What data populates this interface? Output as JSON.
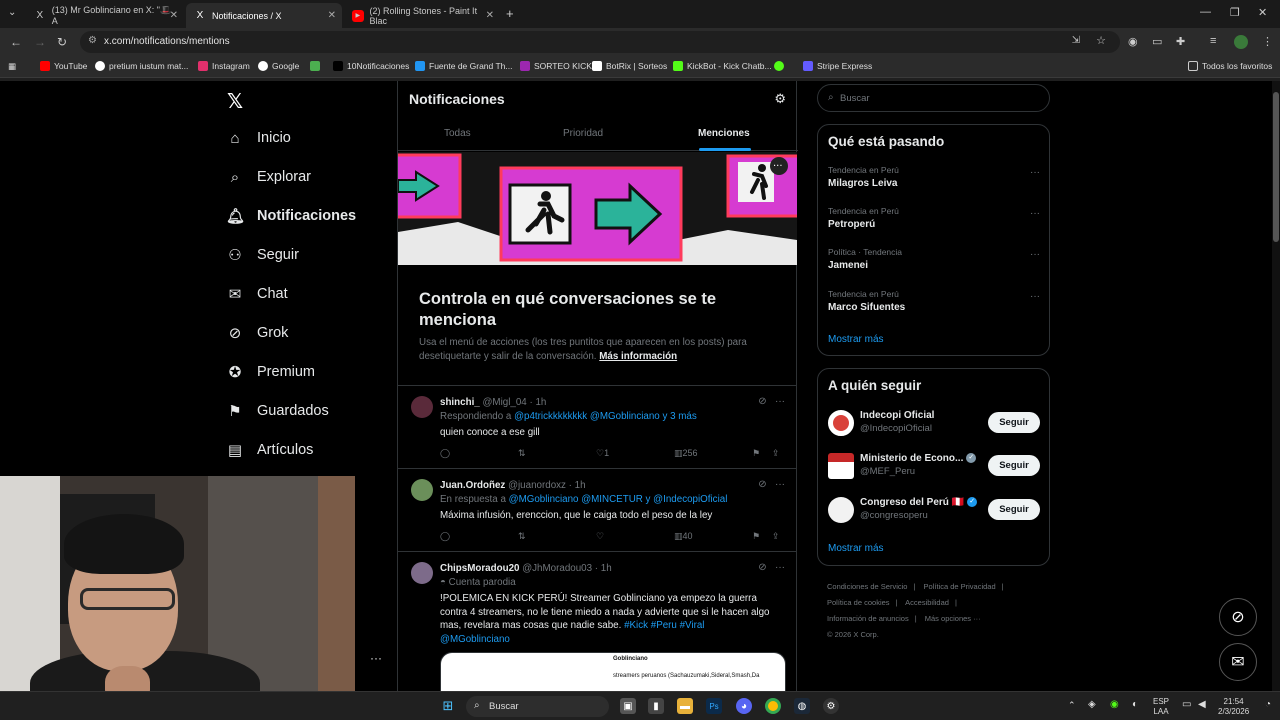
{
  "browser": {
    "tabs": [
      {
        "label": "(13) Mr Goblinciano en X: \"🎩 A",
        "icon": "X"
      },
      {
        "label": "Notificaciones / X",
        "icon": "X"
      },
      {
        "label": "(2) Rolling Stones - Paint It Blac",
        "icon": "▶"
      }
    ],
    "new_tab": "+",
    "url": "x.com/notifications/mentions",
    "bookmarks": [
      "YouTube",
      "pretium iustum mat...",
      "Instagram",
      "Google",
      "",
      "10Notificaciones",
      "Fuente de Grand Th...",
      "SORTEO KICK",
      "BotRix | Sorteos",
      "KickBot - Kick Chatb...",
      "",
      "Stripe Express"
    ],
    "bookmarks_all": "Todos los favoritos"
  },
  "nav": {
    "items": [
      "Inicio",
      "Explorar",
      "Notificaciones",
      "Seguir",
      "Chat",
      "Grok",
      "Premium",
      "Guardados",
      "Artículos"
    ]
  },
  "header": {
    "title": "Notificaciones",
    "tabs": [
      "Todas",
      "Prioridad",
      "Menciones"
    ]
  },
  "promo": {
    "title": "Controla en qué conversaciones se te menciona",
    "body": "Usa el menú de acciones (los tres puntitos que aparecen en los posts) para desetiquetarte y salir de la conversación.",
    "link": "Más información"
  },
  "posts": [
    {
      "name": "shinchi_",
      "handle": "@Migl_04 · 1h",
      "meta_prefix": "Respondiendo a ",
      "meta_links": "@p4trickkkkkkkk @MGoblinciano y 3 más",
      "text": "quien conoce a ese gill",
      "likes": "1",
      "views": "256"
    },
    {
      "name": "Juan.Ordoñez",
      "handle": "@juanordoxz · 1h",
      "meta_prefix": "En respuesta a ",
      "meta_links": "@MGoblinciano @MINCETUR y @IndecopiOficial",
      "text": "Máxima infusión, erenccion, que le caiga todo el peso de la ley",
      "likes": "",
      "views": "40"
    },
    {
      "name": "ChipsMoradou20",
      "handle": "@JhMoradou03 · 1h",
      "meta_prefix": "Cuenta parodia",
      "meta_links": "",
      "text": "!POLEMICA EN KICK PERÚ! Streamer Goblinciano ya empezo la guerra contra 4 streamers, no le tiene miedo a nada y advierte que si le hacen algo mas, revelara mas cosas que nadie sabe. ",
      "tags": "#Kick #Peru #Viral",
      "mention": "@MGoblinciano",
      "card_line1": "Goblinciano",
      "card_line2": "streamers peruanos (Sachauzumaki,Sideral,Smash,Da"
    }
  ],
  "search": {
    "placeholder": "Buscar"
  },
  "trends": {
    "title": "Qué está pasando",
    "items": [
      {
        "category": "Tendencia en Perú",
        "title": "Milagros Leiva"
      },
      {
        "category": "Tendencia en Perú",
        "title": "Petroperú"
      },
      {
        "category": "Política · Tendencia",
        "title": "Jamenei"
      },
      {
        "category": "Tendencia en Perú",
        "title": "Marco Sifuentes"
      }
    ],
    "show_more": "Mostrar más"
  },
  "who_to_follow": {
    "title": "A quién seguir",
    "items": [
      {
        "name": "Indecopi Oficial",
        "handle": "@IndecopiOficial",
        "button": "Seguir"
      },
      {
        "name": "Ministerio de Econo...",
        "handle": "@MEF_Peru",
        "button": "Seguir"
      },
      {
        "name": "Congreso del Perú 🇵🇪",
        "handle": "@congresoperu",
        "button": "Seguir"
      }
    ],
    "show_more": "Mostrar más"
  },
  "footer": {
    "links": [
      "Condiciones de Servicio",
      "|",
      "Política de Privacidad",
      "|",
      "Política de cookies",
      "|",
      "Accesibilidad",
      "|",
      "Información de anuncios",
      "|",
      "Más opciones ···",
      "© 2026 X Corp."
    ]
  },
  "taskbar": {
    "search": "Buscar",
    "lang1": "ESP",
    "lang2": "LAA",
    "time": "21:54",
    "date": "2/3/2026"
  },
  "colors": {
    "accent": "#1d9bf0",
    "background": "#000000",
    "banner_magenta": "#d63bd1",
    "banner_green": "#2bb39a"
  }
}
